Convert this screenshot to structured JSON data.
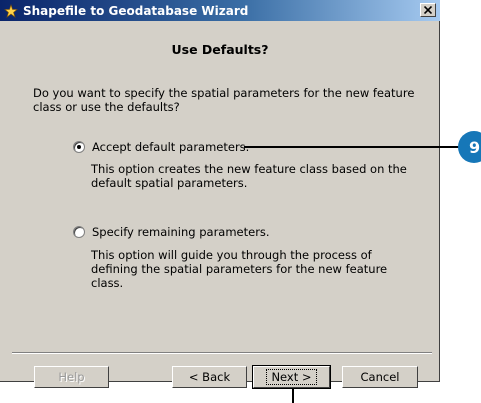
{
  "window": {
    "title": "Shapefile to Geodatabase Wizard",
    "close_label": "×"
  },
  "page": {
    "heading": "Use Defaults?",
    "question": "Do you want to specify the spatial parameters for the new feature class or use the defaults?"
  },
  "options": [
    {
      "label": "Accept default parameters.",
      "description": "This option creates the new feature class based on the default spatial parameters.",
      "selected": true
    },
    {
      "label": "Specify remaining parameters.",
      "description": "This option will guide you through the process of defining the spatial parameters for the new feature class.",
      "selected": false
    }
  ],
  "buttons": {
    "help": "Help",
    "back": "< Back",
    "next": "Next >",
    "cancel": "Cancel"
  },
  "callout": {
    "number": "9",
    "color": "#1677b8"
  },
  "icons": {
    "title": "wizard-icon",
    "close": "close-icon"
  }
}
